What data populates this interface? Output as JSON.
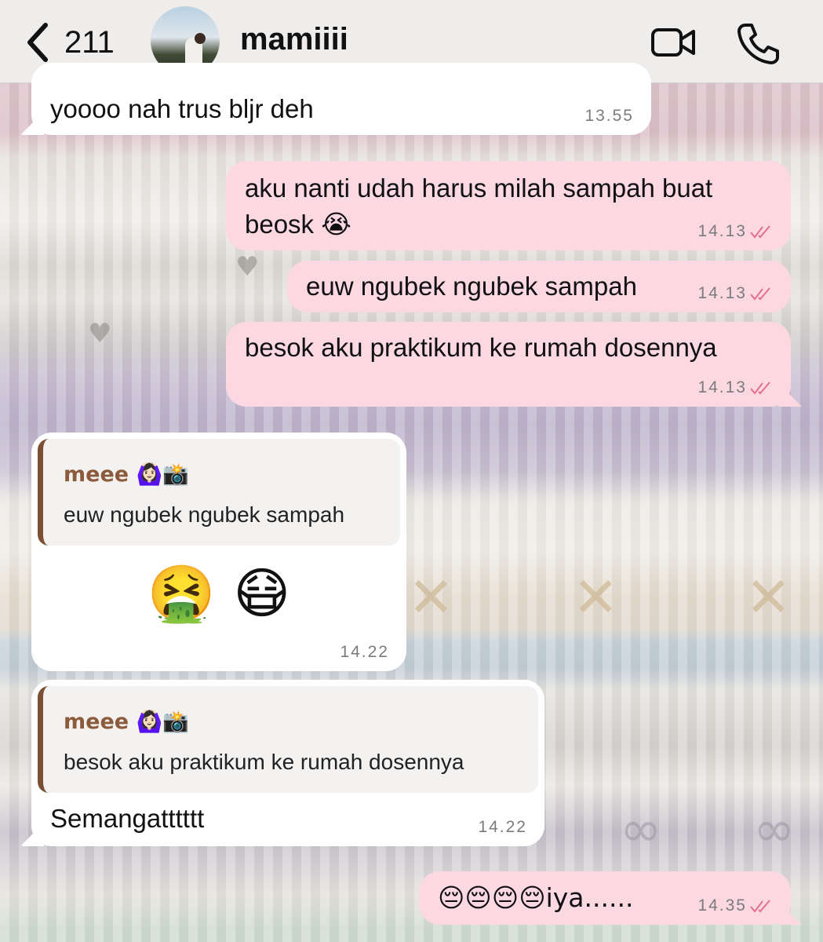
{
  "header": {
    "back_count": "211",
    "contact_name": "mamiiii",
    "video_icon": "video-camera-icon",
    "call_icon": "phone-icon"
  },
  "messages": [
    {
      "direction": "in",
      "text": "yoooo nah trus bljr deh",
      "time": "13.55"
    },
    {
      "direction": "out",
      "text_line1": "aku nanti udah harus milah sampah buat",
      "text_line2": "beosk 😭",
      "time": "14.13",
      "status_icon": "double-check-icon"
    },
    {
      "direction": "out",
      "text": "euw ngubek ngubek sampah",
      "time": "14.13",
      "status_icon": "double-check-icon"
    },
    {
      "direction": "out",
      "text": "besok aku praktikum ke rumah dosennya",
      "time": "14.13",
      "status_icon": "double-check-icon"
    },
    {
      "direction": "in",
      "reply_author": "meee 🙆🏻‍♀️📸",
      "reply_text": "euw ngubek ngubek sampah",
      "text": "🤮 😷",
      "time": "14.22"
    },
    {
      "direction": "in",
      "reply_author": "meee 🙆🏻‍♀️📸",
      "reply_text": "besok aku praktikum ke rumah dosennya",
      "text": "Semangatttttt",
      "time": "14.22"
    },
    {
      "direction": "out",
      "text": "😔😔😔😔iya......",
      "time": "14.35",
      "status_icon": "double-check-icon"
    }
  ],
  "colors": {
    "incoming_bubble": "#ffffff",
    "outgoing_bubble": "#fbd8e2",
    "read_check": "#e36f93",
    "quote_bar": "#7b4f34",
    "quote_author": "#8b5b3c"
  }
}
